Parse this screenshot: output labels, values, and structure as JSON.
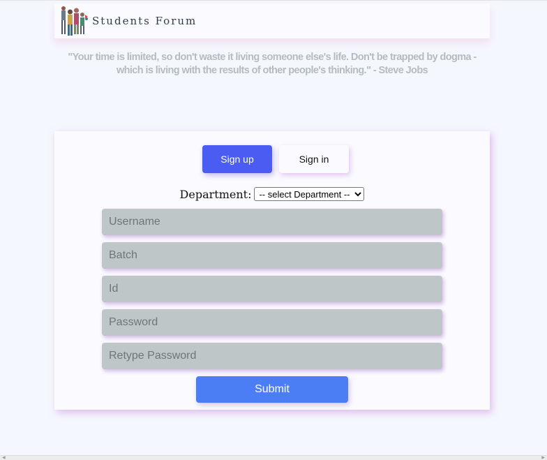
{
  "header": {
    "brand": "Students Forum",
    "logo_icon": "students-group-logo"
  },
  "quote": {
    "text": "\"Your time is limited, so don't waste it living someone else's life. Don't be trapped by dogma - which is living with the results of other people's thinking.\" - Steve Jobs"
  },
  "tabs": {
    "signup_label": "Sign up",
    "signin_label": "Sign in"
  },
  "form": {
    "department_label": "Department:",
    "department_selected": "-- select Department --",
    "fields": {
      "username_placeholder": "Username",
      "batch_placeholder": "Batch",
      "id_placeholder": "Id",
      "password_placeholder": "Password",
      "retype_password_placeholder": "Retype Password"
    },
    "submit_label": "Submit"
  },
  "colors": {
    "accent_primary": "#4a5cf2",
    "submit": "#4b7ef5",
    "field_bg": "#bec6c8",
    "page_bg": "#f5f7fe"
  }
}
